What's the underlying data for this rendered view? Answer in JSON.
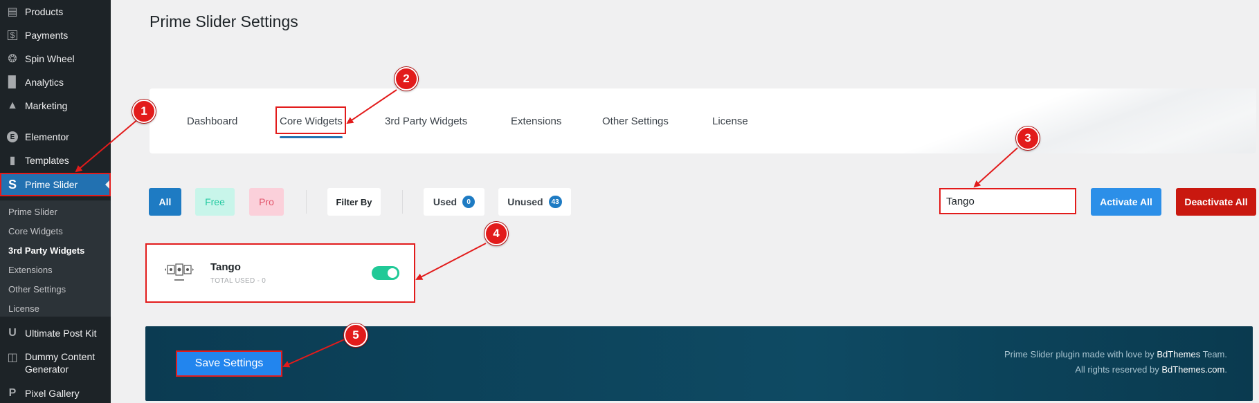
{
  "sidebar": {
    "items": [
      {
        "label": "Products",
        "icon": "archive-icon"
      },
      {
        "label": "Payments",
        "icon": "dollar-icon"
      },
      {
        "label": "Spin Wheel",
        "icon": "wheel-icon"
      },
      {
        "label": "Analytics",
        "icon": "bar-chart-icon"
      },
      {
        "label": "Marketing",
        "icon": "megaphone-icon"
      },
      {
        "label": "Elementor",
        "icon": "elementor-icon"
      },
      {
        "label": "Templates",
        "icon": "folder-icon"
      },
      {
        "label": "Prime Slider",
        "icon": "prime-slider-icon"
      },
      {
        "label": "Ultimate Post Kit",
        "icon": "upk-icon"
      },
      {
        "label": "Dummy Content",
        "icon": "database-icon"
      },
      {
        "label": "Generator",
        "icon": ""
      },
      {
        "label": "Pixel Gallery",
        "icon": "pixel-icon"
      }
    ],
    "submenu": [
      "Prime Slider",
      "Core Widgets",
      "3rd Party Widgets",
      "Extensions",
      "Other Settings",
      "License"
    ]
  },
  "page": {
    "title": "Prime Slider Settings"
  },
  "tabs": [
    "Dashboard",
    "Core Widgets",
    "3rd Party Widgets",
    "Extensions",
    "Other Settings",
    "License"
  ],
  "filters": {
    "all": "All",
    "free": "Free",
    "pro": "Pro",
    "filter_by": "Filter By",
    "used": "Used",
    "used_count": "0",
    "unused": "Unused",
    "unused_count": "43"
  },
  "search": {
    "value": "Tango"
  },
  "actions": {
    "activate_all": "Activate All",
    "deactivate_all": "Deactivate All"
  },
  "widget": {
    "name": "Tango",
    "total_used": "TOTAL USED - 0",
    "enabled": true
  },
  "footer": {
    "save_label": "Save Settings",
    "credit_line1_a": "Prime Slider plugin made with love by ",
    "credit_line1_b": "BdThemes",
    "credit_line1_c": " Team.",
    "credit_line2_a": "All rights reserved by ",
    "credit_line2_b": "BdThemes.com",
    "credit_line2_c": "."
  },
  "annotations": [
    "1",
    "2",
    "3",
    "4",
    "5"
  ],
  "colors": {
    "accent": "#2271b1",
    "annotation": "#e21b1b",
    "toggle_on": "#20c997",
    "danger": "#c9180f"
  }
}
